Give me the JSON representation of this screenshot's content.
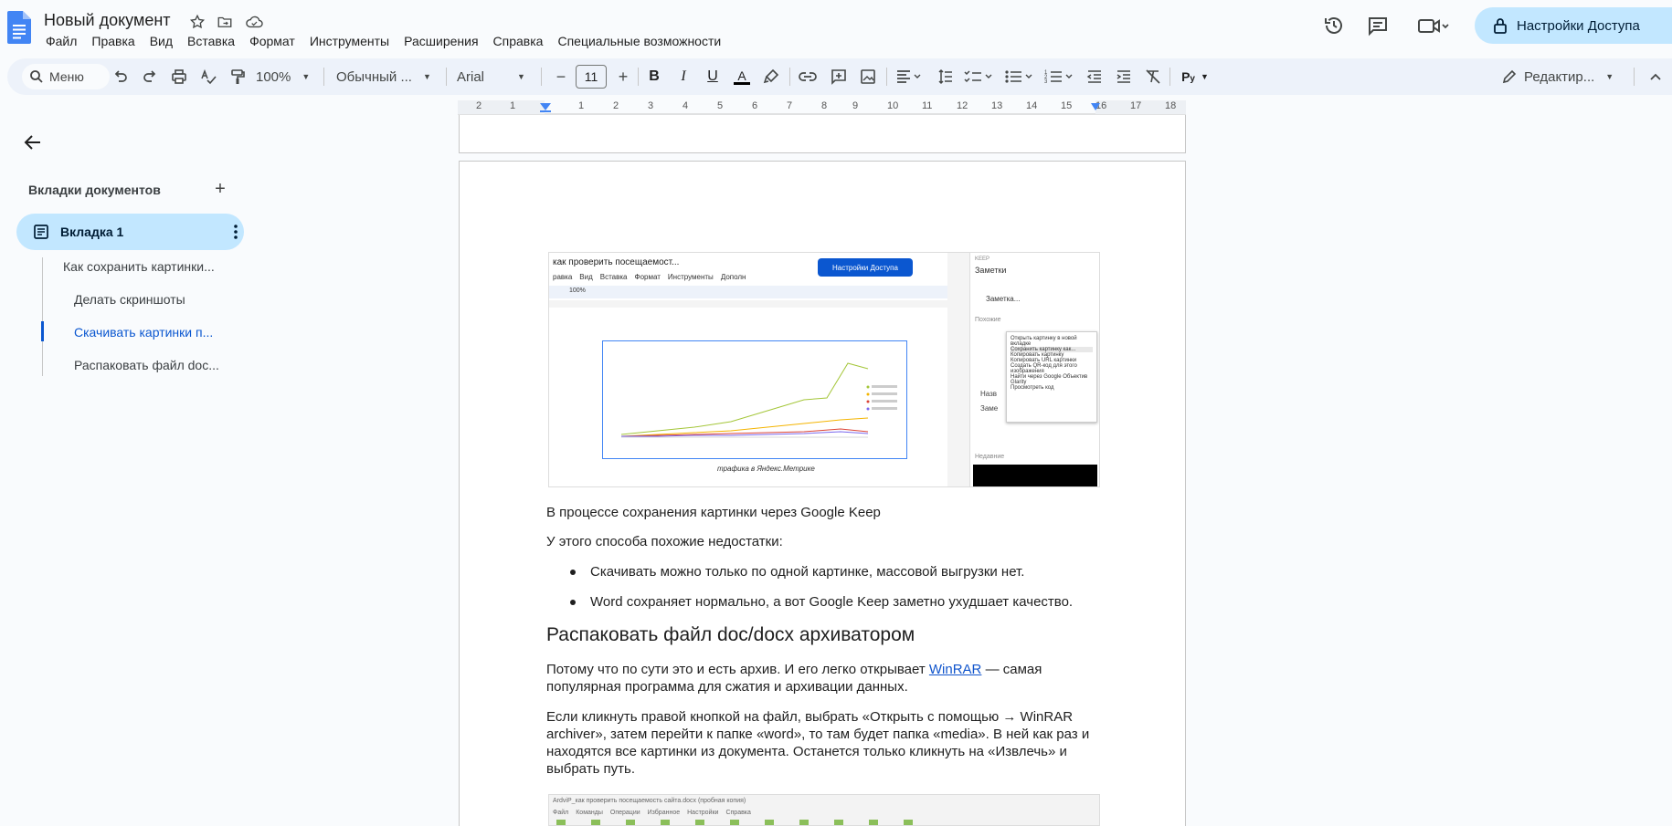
{
  "doc": {
    "title": "Новый документ",
    "menu": [
      "Файл",
      "Правка",
      "Вид",
      "Вставка",
      "Формат",
      "Инструменты",
      "Расширения",
      "Справка",
      "Специальные возможности"
    ],
    "share_label": "Настройки Доступа"
  },
  "toolbar": {
    "menu_search": "Меню",
    "zoom": "100%",
    "style": "Обычный ...",
    "font": "Arial",
    "font_size": "11",
    "mode": "Редактир..."
  },
  "ruler": [
    "2",
    "1",
    "1",
    "2",
    "3",
    "4",
    "5",
    "6",
    "7",
    "8",
    "9",
    "10",
    "11",
    "12",
    "13",
    "14",
    "15",
    "16",
    "17",
    "18"
  ],
  "sidebar": {
    "heading": "Вкладки документов",
    "tab": "Вкладка 1",
    "outline": [
      "Как сохранить картинки...",
      "Делать скриншоты",
      "Скачивать картинки п...",
      "Распаковать файл doc..."
    ]
  },
  "content": {
    "caption": "В процессе сохранения картинки через Google Keep",
    "intro": "У этого способа похожие недостатки:",
    "bullets": [
      "Скачивать можно только по одной картинке, массовой выгрузки нет.",
      "Word сохраняет нормально, а вот Google Keep заметно ухудшает качество."
    ],
    "heading": "Распаковать файл doc/docx архиватором",
    "p1_before": "Потому что по сути это и есть архив. И его легко открывает ",
    "p1_link": "WinRAR",
    "p1_after": " — самая",
    "p1_line2": "популярная программа для сжатия и архивации данных.",
    "p2": [
      "Если кликнуть правой кнопкой на файл, выбрать «Открыть с помощью → WinRAR",
      "archiver», затем перейти к папке «word», то там будет папка «media». В ней как раз и",
      "находятся все картинки из документа. Останется только кликнуть на «Извлечь» и",
      "выбрать путь."
    ]
  },
  "embedded1": {
    "doc_title": "как проверить посещаемост...",
    "menu": [
      "равка",
      "Вид",
      "Вставка",
      "Формат",
      "Инструменты",
      "Дополн"
    ],
    "share": "Настройки Доступа",
    "zoom": "100%",
    "keep_brand": "KEEP",
    "keep_title": "Заметки",
    "keep_new": "Заметка...",
    "keep_similar": "Похожие",
    "keep_recent": "Недавние",
    "context_menu": [
      "Открыть картинку в новой вкладке",
      "Сохранить картинку как...",
      "Копировать картинку",
      "Копировать URL картинки",
      "Создать QR-код для этого изображения",
      "Найти через Google Объектив",
      "Glarity",
      "Просмотреть код"
    ],
    "chart_caption": "трафика в Яндекс.Метрике",
    "keep_fragments": [
      "Назв",
      "Заме"
    ]
  },
  "embedded2": {
    "title": "ArdviP_как проверить посещаемость сайта.docx (пробная копия)",
    "menu": [
      "Файл",
      "Команды",
      "Операции",
      "Избранное",
      "Настройки",
      "Справка"
    ]
  },
  "colors": {
    "accent": "#0b57d0",
    "share_bg": "#c2e7ff",
    "toolbar_bg": "#edf2fa",
    "link": "#1155cc"
  }
}
